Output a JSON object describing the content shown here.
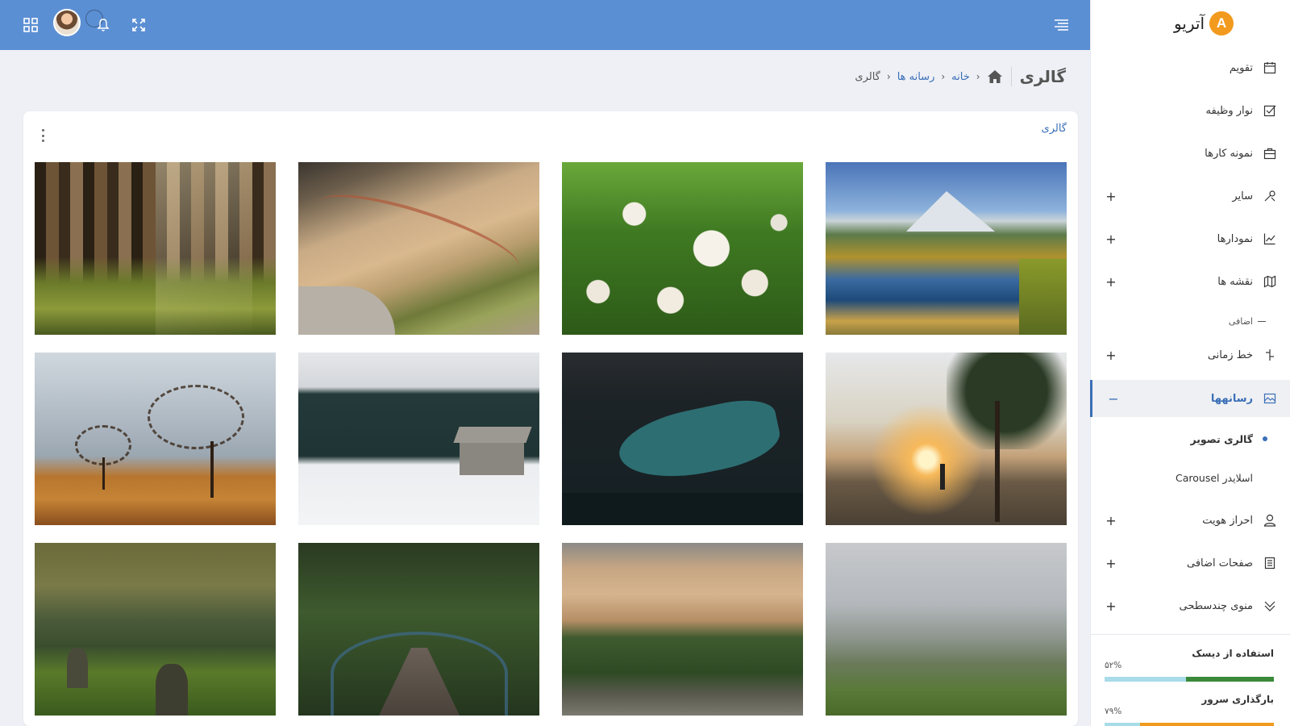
{
  "app": {
    "name": "آتریو",
    "logo_letter": "A"
  },
  "header": {
    "grid_icon": "grid-icon",
    "avatar": "user-avatar",
    "notification_icon": "bell-icon",
    "fullscreen_icon": "expand-icon",
    "menu_icon": "menu-lines-icon"
  },
  "breadcrumb": {
    "title": "گالری",
    "home": "خانه",
    "media": "رسانه ها",
    "current": "گالری"
  },
  "card": {
    "title": "گالری"
  },
  "gallery": {
    "photos": [
      {
        "name": "forest",
        "alt": "جنگل"
      },
      {
        "name": "mountain-slope",
        "alt": "کوهستان"
      },
      {
        "name": "clover-flowers",
        "alt": "گل ها"
      },
      {
        "name": "mountain-lake",
        "alt": "دریاچه کوهستانی"
      },
      {
        "name": "bare-trees",
        "alt": "درختان"
      },
      {
        "name": "snow-cabin",
        "alt": "کلبه برفی"
      },
      {
        "name": "teal-lake",
        "alt": "دریاچه"
      },
      {
        "name": "sunset-tree",
        "alt": "غروب"
      },
      {
        "name": "green-hills",
        "alt": "تپه ها"
      },
      {
        "name": "forest-bridge",
        "alt": "پل جنگلی"
      },
      {
        "name": "cliff-forest",
        "alt": "صخره"
      },
      {
        "name": "foggy-hills",
        "alt": "مه"
      }
    ]
  },
  "sidebar": {
    "items": [
      {
        "label": "تقویم",
        "icon": "calendar-icon"
      },
      {
        "label": "نوار وظیفه",
        "icon": "checkbox-icon"
      },
      {
        "label": "نمونه کارها",
        "icon": "briefcase-icon"
      },
      {
        "label": "سایر",
        "icon": "tools-icon",
        "expand": "+"
      },
      {
        "label": "نمودارها",
        "icon": "trend-chart-icon",
        "expand": "+"
      },
      {
        "label": "نقشه ها",
        "icon": "map-icon",
        "expand": "+"
      },
      {
        "label": "خط زمانی",
        "icon": "timeline-icon",
        "expand": "+"
      },
      {
        "label": "رسانهها",
        "icon": "image-icon",
        "expand": "−"
      },
      {
        "label": "احراز هویت",
        "icon": "user-icon",
        "expand": "+"
      },
      {
        "label": "صفحات اضافی",
        "icon": "document-icon",
        "expand": "+"
      },
      {
        "label": "منوی چندسطحی",
        "icon": "chevrons-icon",
        "expand": "+"
      }
    ],
    "section_extra": "اضافی",
    "sub_items": [
      {
        "label": "گالری تصویر"
      },
      {
        "label": "اسلایدر Carousel"
      }
    ],
    "stats": [
      {
        "title": "استفاده از دیسک",
        "value": "۵۲%",
        "percent": 0.52,
        "color": "#3a8a3a"
      },
      {
        "title": "بارگذاری سرور",
        "value": "۷۹%",
        "percent": 0.79,
        "color": "#f29a1d"
      }
    ]
  }
}
